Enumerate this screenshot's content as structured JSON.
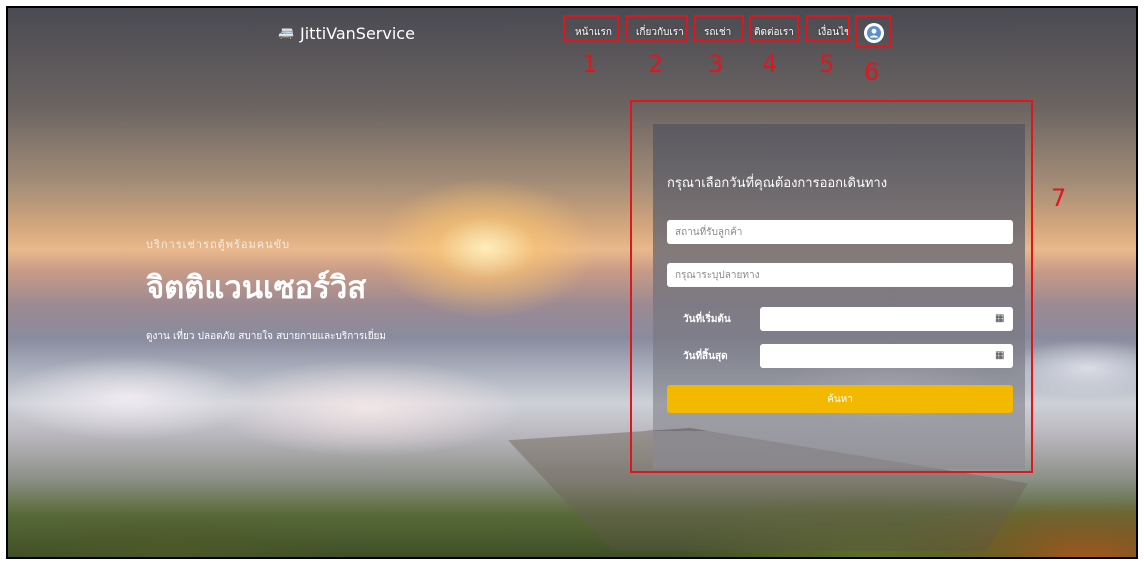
{
  "brand": {
    "logo_text": "JittiVanService",
    "logo_icon": "van-logo-icon"
  },
  "nav": {
    "items": [
      {
        "label": "หน้าแรก"
      },
      {
        "label": "เกี่ยวกับเรา"
      },
      {
        "label": "รถเช่า"
      },
      {
        "label": "ติดต่อเรา"
      },
      {
        "label": "เงื่อนไข"
      }
    ],
    "user_icon": "user-avatar-icon"
  },
  "hero": {
    "subtitle": "บริการเช่ารถตู้พร้อมคนขับ",
    "title": "จิตติแวนเซอร์วิส",
    "description": "ดูงาน เที่ยว ปลอดภัย สบายใจ สบายกายและบริการเยี่ยม"
  },
  "search_form": {
    "heading": "กรุณาเลือกวันที่คุณต้องการออกเดินทาง",
    "pickup_placeholder": "สถานที่รับลูกค้า",
    "destination_placeholder": "กรุณาระบุปลายทาง",
    "start_date_label": "วันที่เริ่มต้น",
    "end_date_label": "วันที่สิ้นสุด",
    "search_label": "ค้นหา",
    "calendar_icon": "calendar-icon"
  },
  "annotations": {
    "numbers": [
      "1",
      "2",
      "3",
      "4",
      "5",
      "6",
      "7"
    ],
    "color": "#e0161d"
  },
  "colors": {
    "accent": "#f3b800",
    "panel": "#5a5a62"
  }
}
